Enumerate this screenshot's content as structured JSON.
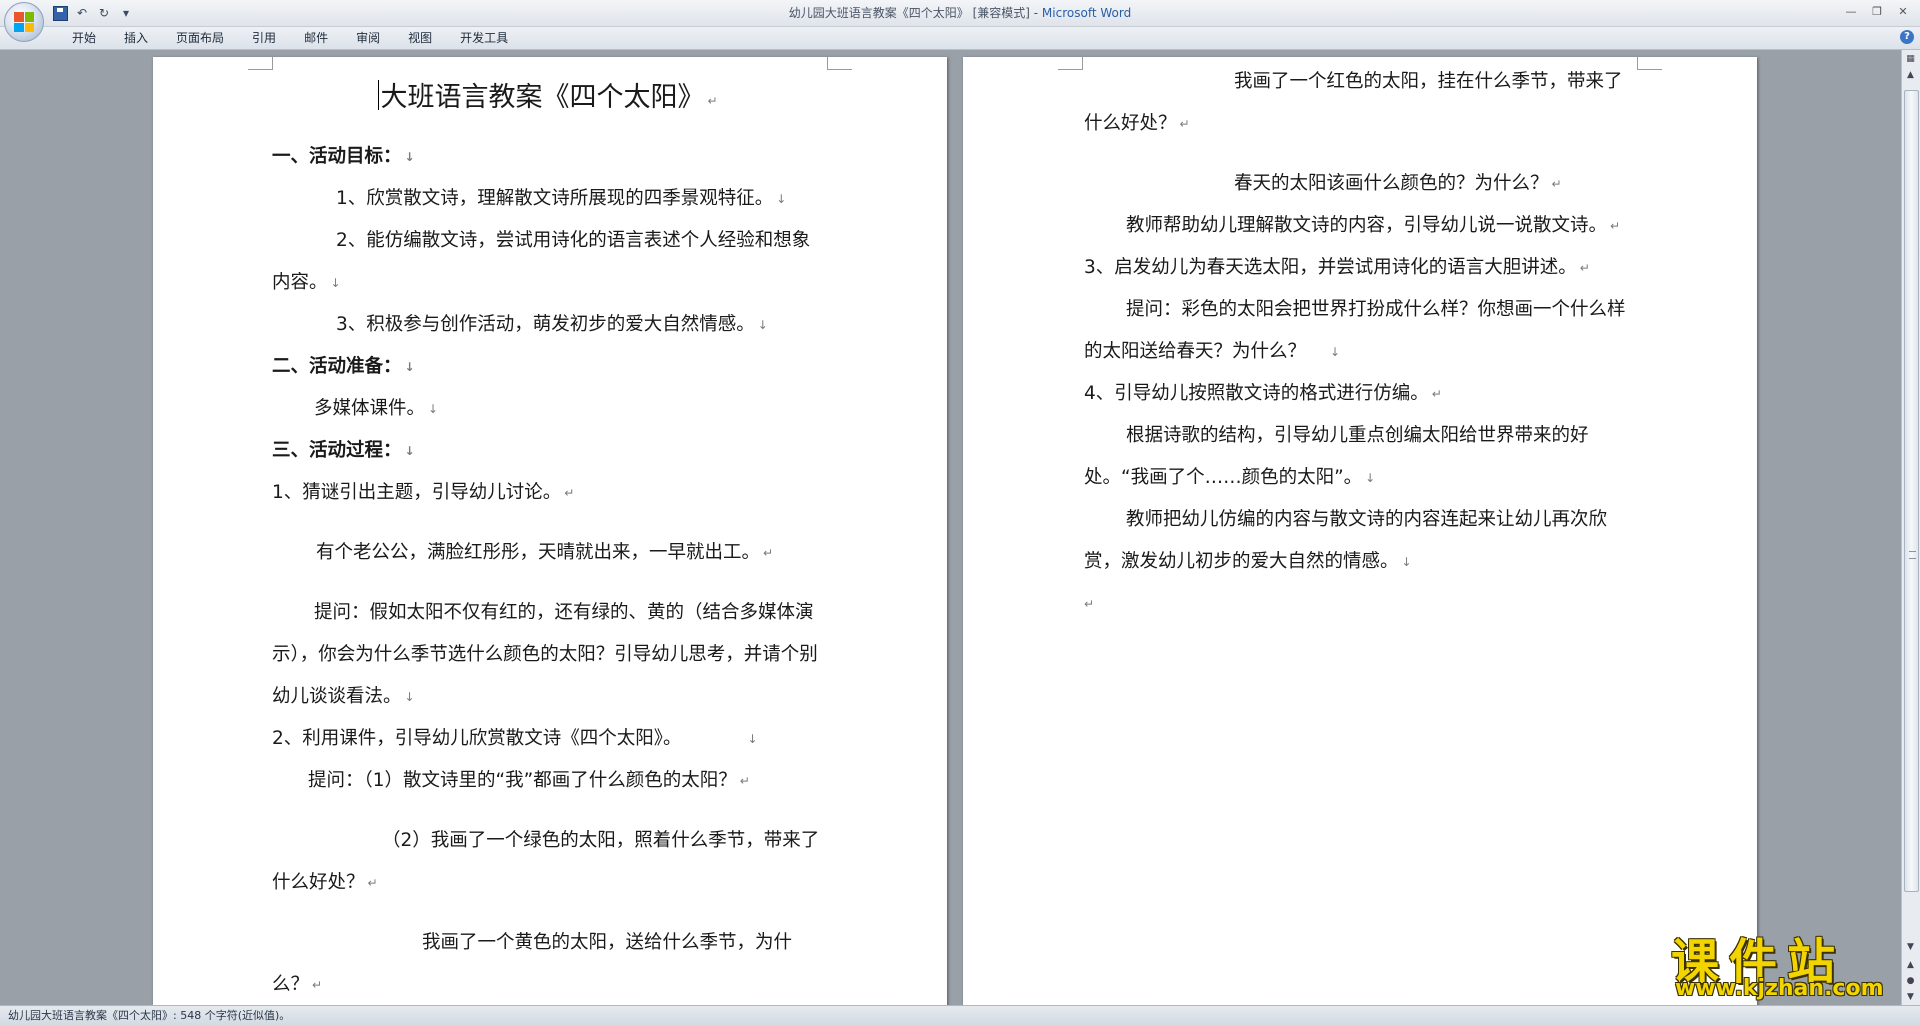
{
  "window": {
    "title_doc": "幼儿园大班语言教案《四个太阳》 [兼容模式] - ",
    "title_app": "Microsoft Word"
  },
  "qat": {
    "undo": "↶",
    "redo": "↻",
    "more": "▾"
  },
  "ribbon": {
    "tabs": [
      "开始",
      "插入",
      "页面布局",
      "引用",
      "邮件",
      "审阅",
      "视图",
      "开发工具"
    ],
    "help": "?"
  },
  "page1": {
    "title": "大班语言教案《四个太阳》",
    "lines": [
      "一、活动目标：",
      "1、欣赏散文诗，理解散文诗所展现的四季景观特征。",
      "2、能仿编散文诗，尝试用诗化的语言表述个人经验和想象内容。",
      "3、积极参与创作活动，萌发初步的爱大自然情感。",
      "二、活动准备：",
      "多媒体课件。",
      "三、活动过程：",
      "1、猜谜引出主题，引导幼儿讨论。",
      "有个老公公，满脸红彤彤，天晴就出来，一早就出工。",
      "提问：假如太阳不仅有红的，还有绿的、黄的（结合多媒体演示），你会为什么季节选什么颜色的太阳？引导幼儿思考，并请个别幼儿谈谈看法。",
      "2、利用课件，引导幼儿欣赏散文诗《四个太阳》。",
      "提问：（1）散文诗里的“我”都画了什么颜色的太阳？",
      "（2）我画了一个绿色的太阳，照着什么季节，带来了什么好处？",
      "我画了一个黄色的太阳，送给什么季节，为什么？"
    ]
  },
  "page2": {
    "lines": [
      "我画了一个红色的太阳，挂在什么季节，带来了什么好处？",
      "春天的太阳该画什么颜色的？为什么？",
      "教师帮助幼儿理解散文诗的内容，引导幼儿说一说散文诗。",
      "3、启发幼儿为春天选太阳，并尝试用诗化的语言大胆讲述。",
      "提问：彩色的太阳会把世界打扮成什么样？你想画一个什么样的太阳送给春天？为什么？",
      "4、引导幼儿按照散文诗的格式进行仿编。",
      "根据诗歌的结构，引导幼儿重点创编太阳给世界带来的好处。“我画了个……颜色的太阳”。",
      "教师把幼儿仿编的内容与散文诗的内容连起来让幼儿再次欣赏，激发幼儿初步的爱大自然的情感。"
    ]
  },
  "marks": {
    "para": "↵",
    "line": "↓"
  },
  "statusbar": {
    "text": "幼儿园大班语言教案《四个太阳》: 548 个字符(近似值)。"
  },
  "watermark": {
    "big": "课件站",
    "small": "www.kjzhan.com"
  }
}
